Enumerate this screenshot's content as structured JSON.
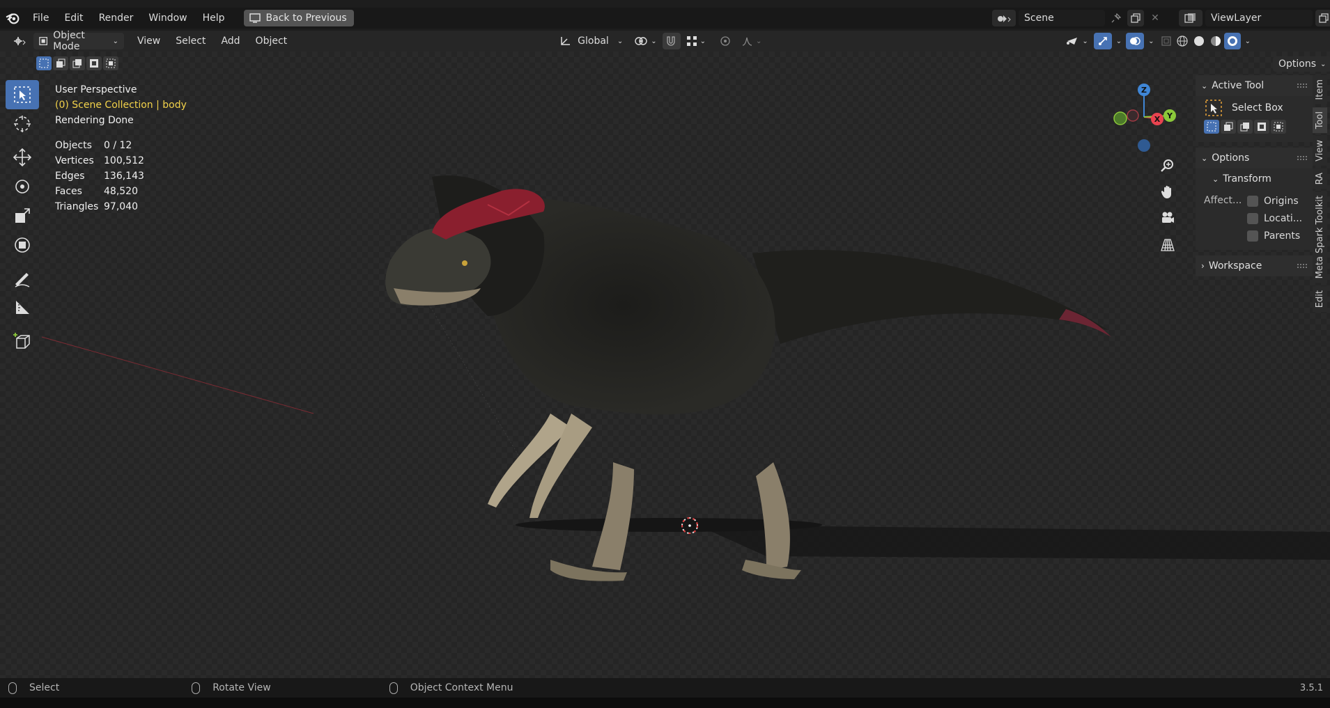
{
  "menu": {
    "items": [
      "File",
      "Edit",
      "Render",
      "Window",
      "Help"
    ],
    "back_button": "Back to Previous"
  },
  "scene": {
    "name": "Scene",
    "view_layer": "ViewLayer"
  },
  "header": {
    "mode": "Object Mode",
    "menus": [
      "View",
      "Select",
      "Add",
      "Object"
    ],
    "orientation": "Global",
    "options_label": "Options"
  },
  "viewport": {
    "perspective": "User Perspective",
    "collection": "(0) Scene Collection | body",
    "status": "Rendering Done",
    "stats": [
      {
        "label": "Objects",
        "value": "0 / 12"
      },
      {
        "label": "Vertices",
        "value": "100,512"
      },
      {
        "label": "Edges",
        "value": "136,143"
      },
      {
        "label": "Faces",
        "value": "48,520"
      },
      {
        "label": "Triangles",
        "value": "97,040"
      }
    ]
  },
  "gizmo": {
    "z": "Z",
    "x": "X",
    "y": "Y"
  },
  "npanel": {
    "active_tool_title": "Active Tool",
    "tool_name": "Select Box",
    "options_title": "Options",
    "transform_title": "Transform",
    "affect_label": "Affect...",
    "affect_options": [
      "Origins",
      "Locati...",
      "Parents"
    ],
    "workspace_title": "Workspace"
  },
  "tabs": [
    "Item",
    "Tool",
    "View",
    "RA",
    "Meta Spark Toolkit",
    "Edit"
  ],
  "statusbar": {
    "select": "Select",
    "rotate": "Rotate View",
    "context": "Object Context Menu",
    "version": "3.5.1"
  },
  "colors": {
    "accent": "#4772b3",
    "collection_text": "#f2d24a",
    "axis_x": "#e8434f",
    "axis_y": "#8bc83a",
    "axis_z": "#3f86d6"
  }
}
